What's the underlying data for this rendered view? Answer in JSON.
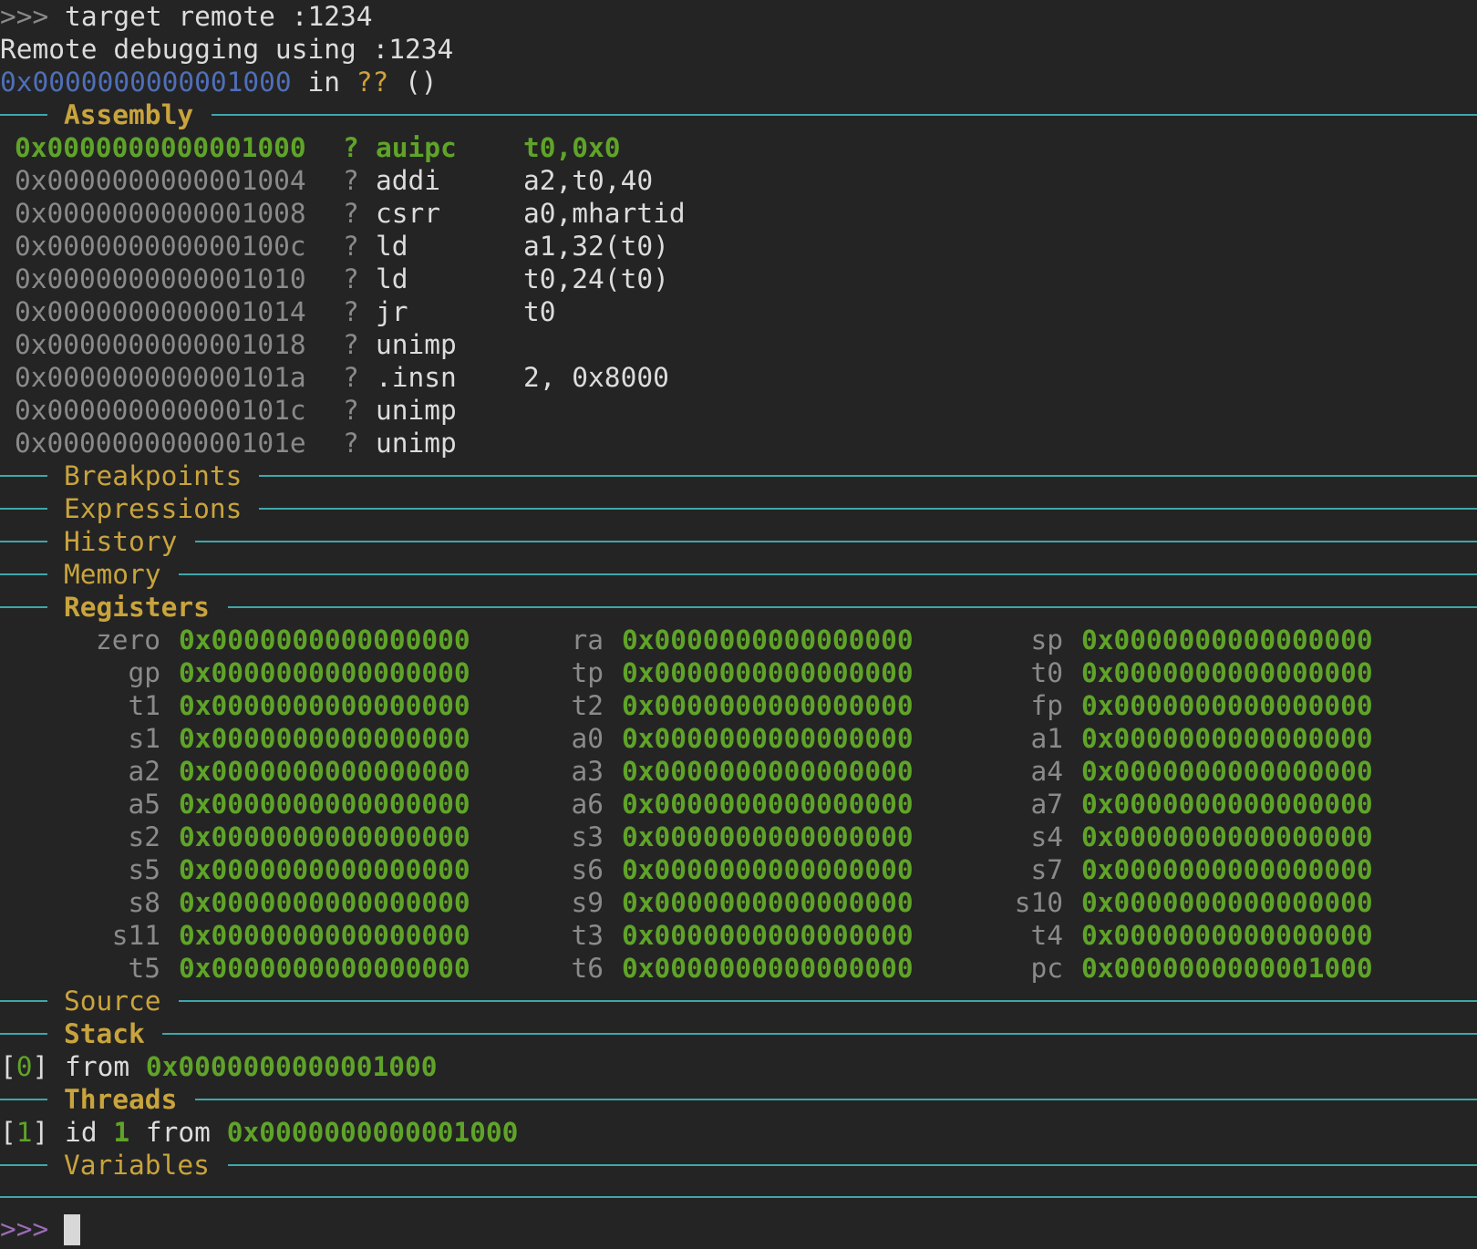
{
  "terminal": {
    "prompt": ">>>",
    "command": " target remote :1234",
    "output_line": "Remote debugging using :1234",
    "location": {
      "address": "0x0000000000001000",
      "in": " in ",
      "func": "??",
      "args": " ()"
    }
  },
  "sections": {
    "assembly": "Assembly",
    "breakpoints": "Breakpoints",
    "expressions": "Expressions",
    "history": "History",
    "memory": "Memory",
    "registers": "Registers",
    "source": "Source",
    "stack": "Stack",
    "threads": "Threads",
    "variables": "Variables"
  },
  "assembly": [
    {
      "addr": "0x0000000000001000",
      "q": "?",
      "mnemonic": "auipc",
      "operands": "t0,0x0"
    },
    {
      "addr": "0x0000000000001004",
      "q": "?",
      "mnemonic": "addi",
      "operands": "a2,t0,40"
    },
    {
      "addr": "0x0000000000001008",
      "q": "?",
      "mnemonic": "csrr",
      "operands": "a0,mhartid"
    },
    {
      "addr": "0x000000000000100c",
      "q": "?",
      "mnemonic": "ld",
      "operands": "a1,32(t0)"
    },
    {
      "addr": "0x0000000000001010",
      "q": "?",
      "mnemonic": "ld",
      "operands": "t0,24(t0)"
    },
    {
      "addr": "0x0000000000001014",
      "q": "?",
      "mnemonic": "jr",
      "operands": "t0"
    },
    {
      "addr": "0x0000000000001018",
      "q": "?",
      "mnemonic": "unimp",
      "operands": ""
    },
    {
      "addr": "0x000000000000101a",
      "q": "?",
      "mnemonic": ".insn",
      "operands": "2, 0x8000"
    },
    {
      "addr": "0x000000000000101c",
      "q": "?",
      "mnemonic": "unimp",
      "operands": ""
    },
    {
      "addr": "0x000000000000101e",
      "q": "?",
      "mnemonic": "unimp",
      "operands": ""
    }
  ],
  "registers": [
    [
      "zero",
      "0x0000000000000000",
      "ra",
      "0x0000000000000000",
      "sp",
      "0x0000000000000000"
    ],
    [
      "gp",
      "0x0000000000000000",
      "tp",
      "0x0000000000000000",
      "t0",
      "0x0000000000000000"
    ],
    [
      "t1",
      "0x0000000000000000",
      "t2",
      "0x0000000000000000",
      "fp",
      "0x0000000000000000"
    ],
    [
      "s1",
      "0x0000000000000000",
      "a0",
      "0x0000000000000000",
      "a1",
      "0x0000000000000000"
    ],
    [
      "a2",
      "0x0000000000000000",
      "a3",
      "0x0000000000000000",
      "a4",
      "0x0000000000000000"
    ],
    [
      "a5",
      "0x0000000000000000",
      "a6",
      "0x0000000000000000",
      "a7",
      "0x0000000000000000"
    ],
    [
      "s2",
      "0x0000000000000000",
      "s3",
      "0x0000000000000000",
      "s4",
      "0x0000000000000000"
    ],
    [
      "s5",
      "0x0000000000000000",
      "s6",
      "0x0000000000000000",
      "s7",
      "0x0000000000000000"
    ],
    [
      "s8",
      "0x0000000000000000",
      "s9",
      "0x0000000000000000",
      "s10",
      "0x0000000000000000"
    ],
    [
      "s11",
      "0x0000000000000000",
      "t3",
      "0x0000000000000000",
      "t4",
      "0x0000000000000000"
    ],
    [
      "t5",
      "0x0000000000000000",
      "t6",
      "0x0000000000000000",
      "pc",
      "0x0000000000001000"
    ]
  ],
  "stack": {
    "open": "[",
    "index": "0",
    "close": "]",
    "from": " from ",
    "address": "0x0000000000001000"
  },
  "threads": {
    "open": "[",
    "index": "1",
    "close": "]",
    "id_label": " id ",
    "id": "1",
    "from": " from ",
    "address": "0x0000000000001000"
  },
  "input_prompt": ">>>"
}
